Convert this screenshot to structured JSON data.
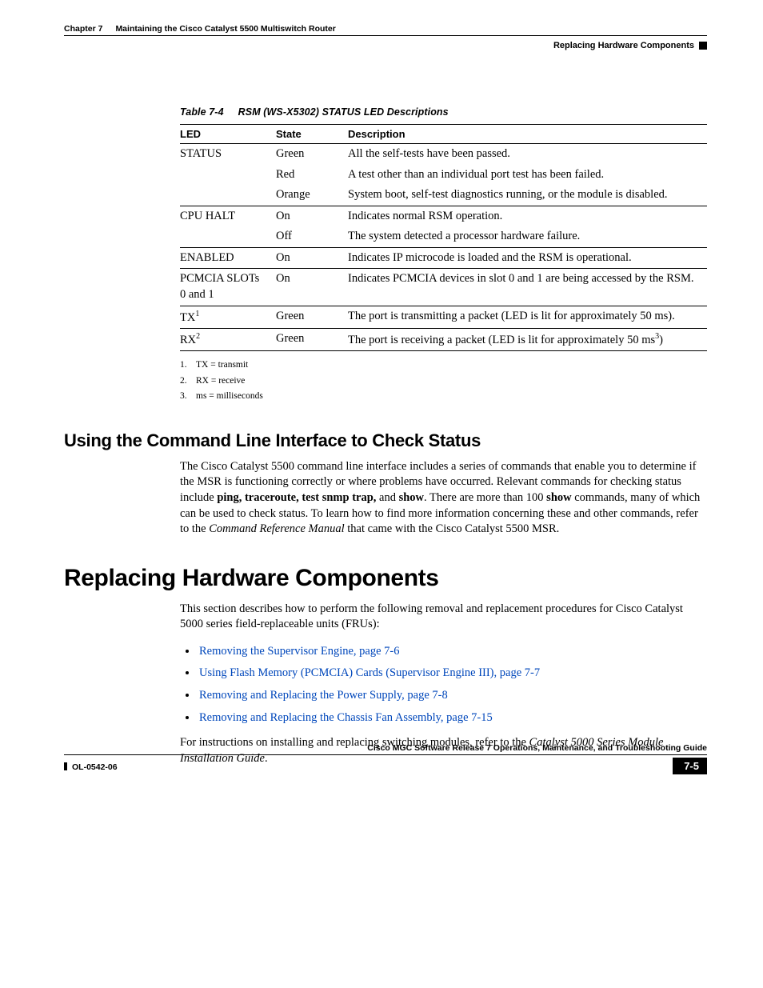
{
  "header": {
    "chapter_label": "Chapter 7",
    "chapter_title": "Maintaining the Cisco Catalyst 5500 Multiswitch Router",
    "section_title": "Replacing Hardware Components"
  },
  "table": {
    "caption_number": "Table 7-4",
    "caption_title": "RSM (WS-X5302) STATUS LED Descriptions",
    "headers": {
      "led": "LED",
      "state": "State",
      "description": "Description"
    },
    "rows": [
      {
        "led": "STATUS",
        "state": "Green",
        "desc": "All the self-tests have been passed.",
        "sep": true
      },
      {
        "led": "",
        "state": "Red",
        "desc": "A test other than an individual port test has been failed."
      },
      {
        "led": "",
        "state": "Orange",
        "desc": "System boot, self-test diagnostics running, or the module is disabled."
      },
      {
        "led": "CPU HALT",
        "state": "On",
        "desc": "Indicates normal RSM operation.",
        "sep": true
      },
      {
        "led": "",
        "state": "Off",
        "desc": "The system detected a processor hardware failure."
      },
      {
        "led": "ENABLED",
        "state": "On",
        "desc": "Indicates IP microcode is loaded and the RSM is operational.",
        "sep": true
      },
      {
        "led": "PCMCIA SLOTs 0 and 1",
        "state": "On",
        "desc": "Indicates PCMCIA devices in slot 0 and 1 are being accessed by the RSM.",
        "sep": true
      },
      {
        "led_html": "TX<sup>1</sup>",
        "state": "Green",
        "desc": "The port is transmitting a packet (LED is lit for approximately 50 ms).",
        "sep": true
      },
      {
        "led_html": "RX<sup>2</sup>",
        "state": "Green",
        "desc_html": "The port is receiving a packet (LED is lit for approximately 50 ms<sup>3</sup>)",
        "sep": true,
        "last": true
      }
    ]
  },
  "footnotes": [
    {
      "n": "1.",
      "text": "TX = transmit"
    },
    {
      "n": "2.",
      "text": "RX = receive"
    },
    {
      "n": "3.",
      "text": "ms = milliseconds"
    }
  ],
  "h2_cli": "Using the Command Line Interface to Check Status",
  "cli_para": {
    "pre": "The Cisco Catalyst 5500 command line interface includes a series of commands that enable you to determine if the MSR is functioning correctly or where problems have occurred. Relevant commands for checking status include ",
    "bold1": "ping, traceroute, test snmp trap,",
    "mid1": " and ",
    "bold2": "show",
    "mid2": ". There are more than 100 ",
    "bold3": "show",
    "mid3": " commands, many of which can be used to check status. To learn how to find more information concerning these and other commands, refer to the ",
    "ital": "Command Reference Manual",
    "post": " that came with the Cisco Catalyst 5500 MSR."
  },
  "h1_replace": "Replacing Hardware Components",
  "replace_intro": "This section describes how to perform the following removal and replacement procedures for Cisco Catalyst 5000 series field-replaceable units (FRUs):",
  "links": [
    "Removing the Supervisor Engine, page 7-6",
    "Using Flash Memory (PCMCIA) Cards (Supervisor Engine III), page 7-7",
    "Removing and Replacing the Power Supply, page 7-8",
    "Removing and Replacing the Chassis Fan Assembly, page 7-15"
  ],
  "replace_outro": {
    "pre": "For instructions on installing and replacing switching modules, refer to the ",
    "ital": "Catalyst 5000 Series Module Installation Guide",
    "post": "."
  },
  "footer": {
    "book_title": "Cisco MGC Software Release 7 Operations, Maintenance, and Troubleshooting Guide",
    "doc_id": "OL-0542-06",
    "page_number": "7-5"
  }
}
